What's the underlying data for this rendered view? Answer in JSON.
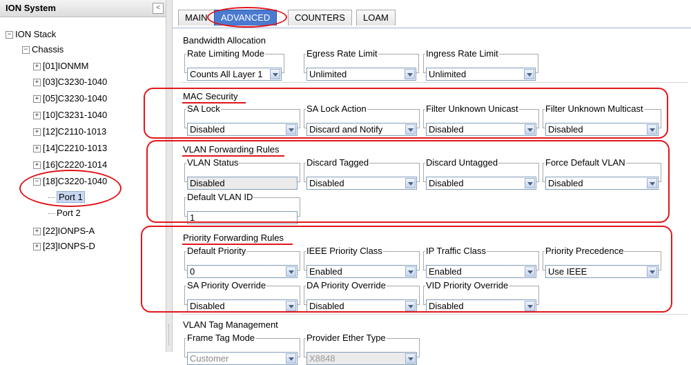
{
  "tree": {
    "title": "ION System",
    "collapse_glyph": "<",
    "nodes": [
      {
        "label": "ION Stack",
        "expander": "−"
      },
      {
        "label": "Chassis",
        "expander": "−"
      },
      {
        "label": "[01]IONMM",
        "expander": "+"
      },
      {
        "label": "[03]C3230-1040",
        "expander": "+"
      },
      {
        "label": "[05]C3230-1040",
        "expander": "+"
      },
      {
        "label": "[10]C3231-1040",
        "expander": "+"
      },
      {
        "label": "[12]C2110-1013",
        "expander": "+"
      },
      {
        "label": "[14]C2210-1013",
        "expander": "+"
      },
      {
        "label": "[16]C2220-1014",
        "expander": "+"
      },
      {
        "label": "[18]C3220-1040",
        "expander": "−"
      },
      {
        "label": "Port 1"
      },
      {
        "label": "Port 2"
      },
      {
        "label": "[22]IONPS-A",
        "expander": "+"
      },
      {
        "label": "[23]IONPS-D",
        "expander": "+"
      }
    ]
  },
  "tabs": [
    "MAIN",
    "ADVANCED",
    "COUNTERS",
    "LOAM"
  ],
  "active_tab": "ADVANCED",
  "sections": {
    "bandwidth": {
      "title": "Bandwidth Allocation",
      "rate_limiting_mode": {
        "label": "Rate Limiting Mode",
        "value": "Counts All Layer 1"
      },
      "egress_rate_limit": {
        "label": "Egress Rate Limit",
        "value": "Unlimited"
      },
      "ingress_rate_limit": {
        "label": "Ingress Rate Limit",
        "value": "Unlimited"
      }
    },
    "mac_security": {
      "title": "MAC Security",
      "sa_lock": {
        "label": "SA Lock",
        "value": "Disabled"
      },
      "sa_lock_action": {
        "label": "SA Lock Action",
        "value": "Discard and Notify"
      },
      "filter_unknown_unicast": {
        "label": "Filter Unknown Unicast",
        "value": "Disabled"
      },
      "filter_unknown_multicast": {
        "label": "Filter Unknown Multicast",
        "value": "Disabled"
      }
    },
    "vlan_forwarding": {
      "title": "VLAN Forwarding Rules",
      "vlan_status": {
        "label": "VLAN Status",
        "value": "Disabled"
      },
      "discard_tagged": {
        "label": "Discard Tagged",
        "value": "Disabled"
      },
      "discard_untagged": {
        "label": "Discard Untagged",
        "value": "Disabled"
      },
      "force_default_vlan": {
        "label": "Force Default VLAN",
        "value": "Disabled"
      },
      "default_vlan_id": {
        "label": "Default VLAN ID",
        "value": "1"
      }
    },
    "priority_forwarding": {
      "title": "Priority Forwarding Rules",
      "default_priority": {
        "label": "Default Priority",
        "value": "0"
      },
      "ieee_priority_class": {
        "label": "IEEE Priority Class",
        "value": "Enabled"
      },
      "ip_traffic_class": {
        "label": "IP Traffic Class",
        "value": "Enabled"
      },
      "priority_precedence": {
        "label": "Priority Precedence",
        "value": "Use IEEE"
      },
      "sa_priority_override": {
        "label": "SA Priority Override",
        "value": "Disabled"
      },
      "da_priority_override": {
        "label": "DA Priority Override",
        "value": "Disabled"
      },
      "vid_priority_override": {
        "label": "VID Priority Override",
        "value": "Disabled"
      }
    },
    "vlan_tag": {
      "title": "VLAN Tag Management",
      "frame_tag_mode": {
        "label": "Frame Tag Mode",
        "value": "Customer"
      },
      "provider_ether_type": {
        "label": "Provider Ether Type",
        "value": "X8848"
      }
    }
  },
  "colors": {
    "annotation_red": "#e0161b",
    "active_tab_blue": "#4b7ad0"
  }
}
